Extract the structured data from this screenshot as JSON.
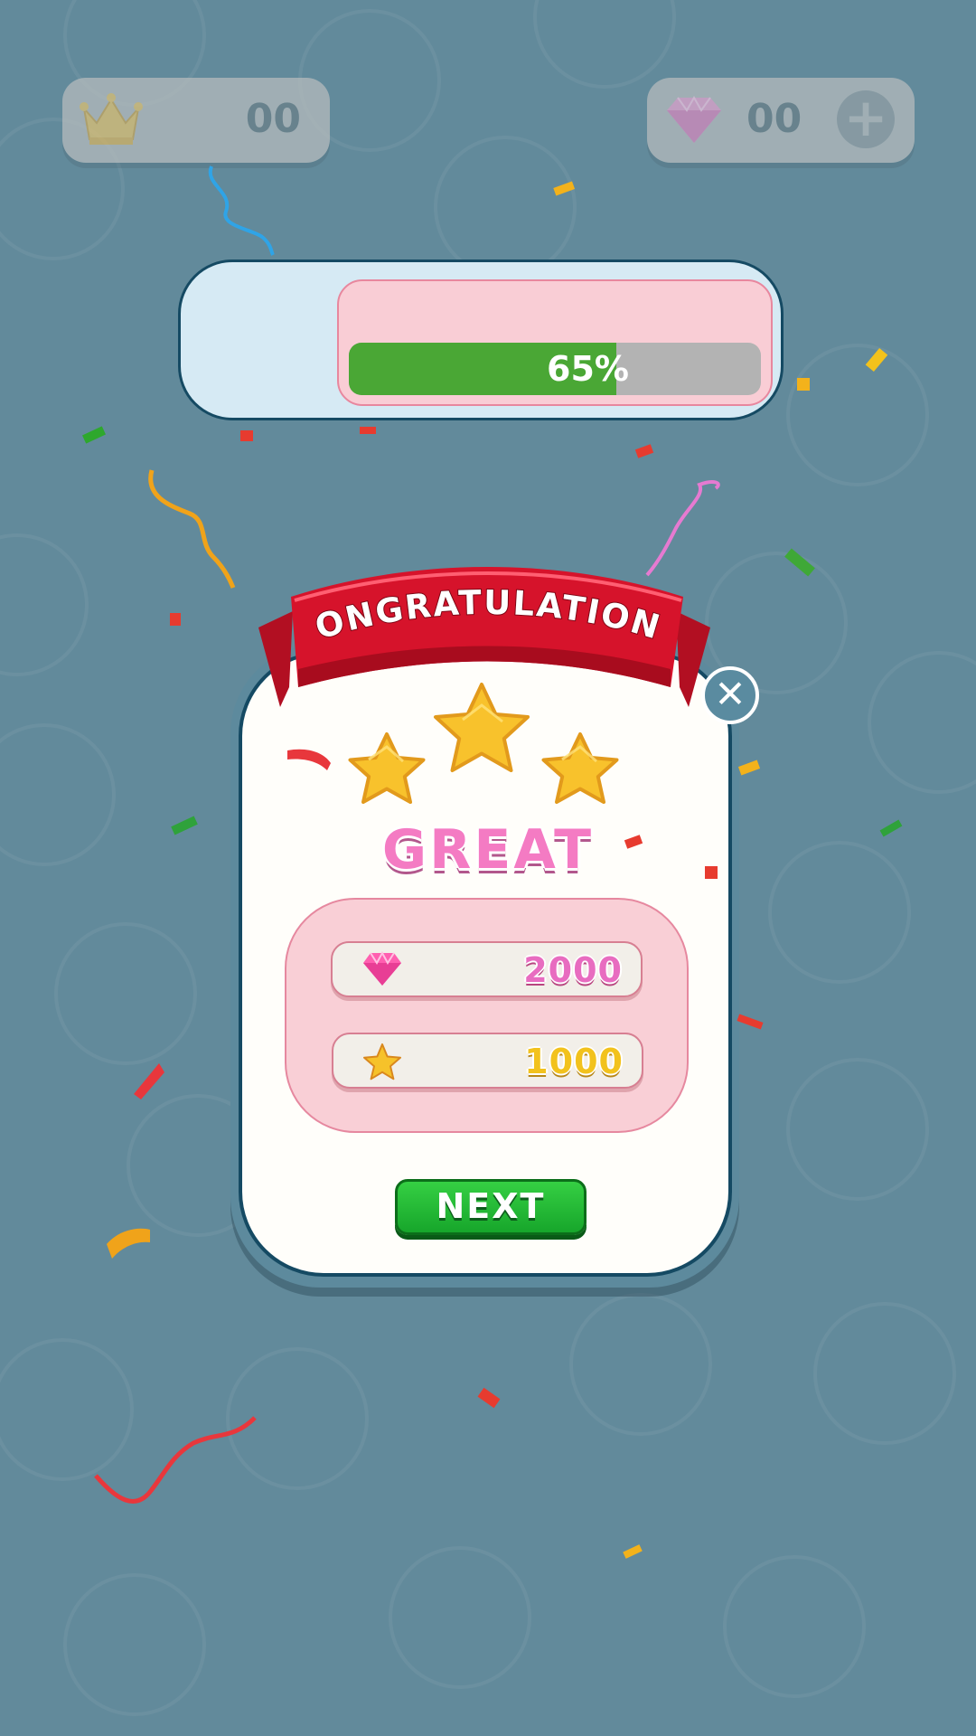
{
  "hud": {
    "crown_count": "00",
    "gem_count": "00",
    "crown_icon": "crown-icon",
    "gem_icon": "gem-icon",
    "plus_icon": "plus-icon"
  },
  "progress": {
    "fraction": 0.65,
    "label": "65%"
  },
  "dialog": {
    "banner_title": "CONGRATULATIONS",
    "stars_earned": 3,
    "rating": "GREAT",
    "rewards": {
      "gems": "2000",
      "stars": "1000"
    },
    "next_label": "NEXT",
    "close_icon": "close-icon"
  },
  "colors": {
    "background": "#628a9b",
    "progress_fill": "#4aa735",
    "banner_red": "#d6132b",
    "rating_pink": "#f47bc3",
    "gem_pink": "#e86cc0",
    "star_gold": "#f2c21d",
    "next_green": "#26b834"
  }
}
